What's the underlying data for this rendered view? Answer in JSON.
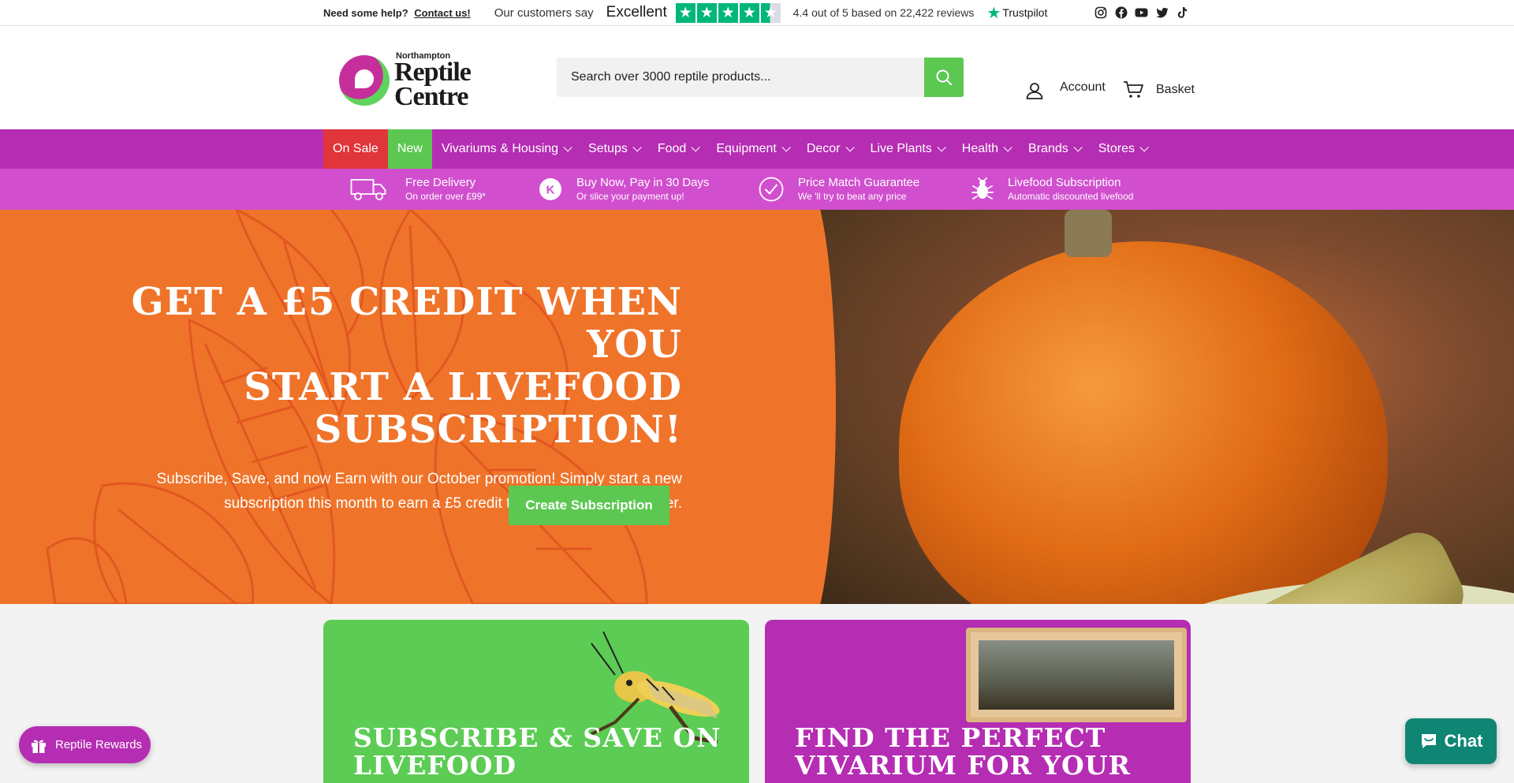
{
  "topbar": {
    "help_text": "Need some help?",
    "help_link": "Contact us!",
    "customers_say": "Our customers say",
    "rating_word": "Excellent",
    "rating_text": "4.4 out of 5 based on 22,422 reviews",
    "trustpilot": "Trustpilot",
    "social_icons": [
      "instagram-icon",
      "facebook-icon",
      "youtube-icon",
      "twitter-icon",
      "tiktok-icon"
    ]
  },
  "header": {
    "logo_small": "Northampton",
    "logo_line1": "Reptile",
    "logo_line2": "Centre",
    "search_placeholder": "Search over 3000 reptile products...",
    "account_label": "Account",
    "basket_label": "Basket"
  },
  "nav": {
    "items": [
      {
        "label": "On Sale",
        "dropdown": false
      },
      {
        "label": "New",
        "dropdown": false
      },
      {
        "label": "Vivariums & Housing",
        "dropdown": true
      },
      {
        "label": "Setups",
        "dropdown": true
      },
      {
        "label": "Food",
        "dropdown": true
      },
      {
        "label": "Equipment",
        "dropdown": true
      },
      {
        "label": "Decor",
        "dropdown": true
      },
      {
        "label": "Live Plants",
        "dropdown": true
      },
      {
        "label": "Health",
        "dropdown": true
      },
      {
        "label": "Brands",
        "dropdown": true
      },
      {
        "label": "Stores",
        "dropdown": true
      }
    ]
  },
  "usp": [
    {
      "title": "Free Delivery",
      "subtitle": "On order over £99*",
      "icon": "truck-icon"
    },
    {
      "title": "Buy Now, Pay in 30 Days",
      "subtitle": "Or slice your payment up!",
      "icon": "klarna-icon"
    },
    {
      "title": "Price Match Guarantee",
      "subtitle": "We 'll try to beat any price",
      "icon": "check-circle-icon"
    },
    {
      "title": "Livefood Subscription",
      "subtitle": "Automatic discounted livefood",
      "icon": "bug-icon"
    }
  ],
  "hero": {
    "title_line1": "GET A £5 CREDIT WHEN YOU",
    "title_line2": "START A LIVEFOOD",
    "title_line3": "SUBSCRIPTION!",
    "subtitle_line1": "Subscribe, Save, and now Earn with our October promotion! Simply start a new",
    "subtitle_line2": "subscription this month to earn a £5 credit to spend on a future order.",
    "button_label": "Create Subscription"
  },
  "cards": [
    {
      "title_line1": "SUBSCRIBE & SAVE ON",
      "title_line2": "LIVEFOOD"
    },
    {
      "title_line1": "FIND THE PERFECT",
      "title_line2": "VIVARIUM FOR YOUR PET"
    }
  ],
  "widgets": {
    "rewards_label": "Reptile Rewards",
    "chat_label": "Chat"
  },
  "colors": {
    "brand_purple": "#b52db3",
    "usp_purple": "#d14fcf",
    "brand_green": "#5cc852",
    "sale_red": "#e0353b",
    "hero_orange": "#ef742a",
    "trustpilot_green": "#00b67a",
    "chat_teal": "#0f8573"
  }
}
